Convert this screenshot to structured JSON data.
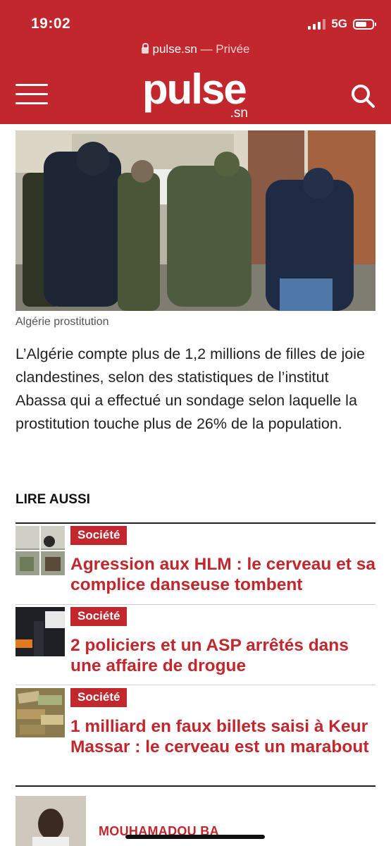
{
  "status_bar": {
    "time": "19:02",
    "network": "5G"
  },
  "browser": {
    "domain": "pulse.sn",
    "separator": " — ",
    "mode": "Privée"
  },
  "header": {
    "logo_text": "pulse",
    "logo_sub": ".sn",
    "menu_icon": "hamburger-menu-icon",
    "search_icon": "search-icon"
  },
  "article": {
    "image_caption": "Algérie prostitution",
    "body": "L’Algérie compte plus de 1,2 millions de filles de joie clandestines, selon des statistiques de l’institut Abassa qui a effectué un sondage selon laquelle la prostitution touche plus de 26% de la population."
  },
  "lire_aussi": {
    "heading": "LIRE AUSSI",
    "items": [
      {
        "category": "Société",
        "title": "Agression aux HLM : le cerveau et sa complice danseuse tombent"
      },
      {
        "category": "Société",
        "title": "2 policiers et un ASP arrêtés dans une affaire de drogue"
      },
      {
        "category": "Société",
        "title": "1 milliard en faux billets saisi à Keur Massar : le cerveau est un marabout"
      }
    ]
  },
  "author": {
    "name": "MOUHAMADOU BA"
  },
  "colors": {
    "brand": "#c1272d",
    "text": "#222222",
    "caption": "#555555"
  }
}
